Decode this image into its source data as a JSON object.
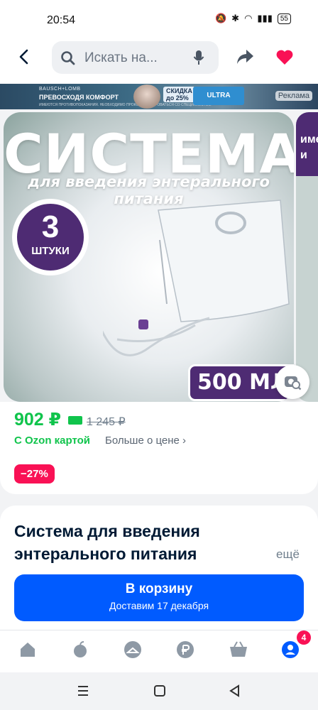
{
  "status_bar": {
    "time": "20:54",
    "battery": "55"
  },
  "search": {
    "placeholder": "Искать на..."
  },
  "ad": {
    "brand": "BAUSCH+LOMB",
    "headline": "ПРЕВОСХОДЯ КОМФОРТ",
    "fine_print": "ИМЕЮТСЯ ПРОТИВОПОКАЗАНИЯ. НЕОБХОДИМО ПРОКОНСУЛЬТИРОВАТЬСЯ СО СПЕЦИАЛИСТОМ",
    "discount_label": "СКИДКА",
    "discount_value": "до 25%",
    "product": "ULTRA",
    "tag": "Реклама"
  },
  "image": {
    "title": "СИСТЕМА",
    "subtitle": "для введения энтерального питания",
    "count_number": "3",
    "count_word": "ШТУКИ",
    "volume": "500 МЛ",
    "next_slide_text": "име и"
  },
  "price": {
    "current": "902 ₽",
    "old": "1 245 ₽",
    "ozon_card": "С Ozon картой",
    "more": "Больше о цене",
    "discount_badge": "−27%"
  },
  "product": {
    "title": "Система для введения энтерального питания",
    "more": "ещё"
  },
  "cart": {
    "label": "В корзину",
    "delivery": "Доставим 17 декабря"
  },
  "nav": {
    "profile_badge": "4"
  },
  "colors": {
    "ozon_blue": "#005bff",
    "green": "#10c44c",
    "pink": "#f91155",
    "purple": "#4e2b73"
  }
}
